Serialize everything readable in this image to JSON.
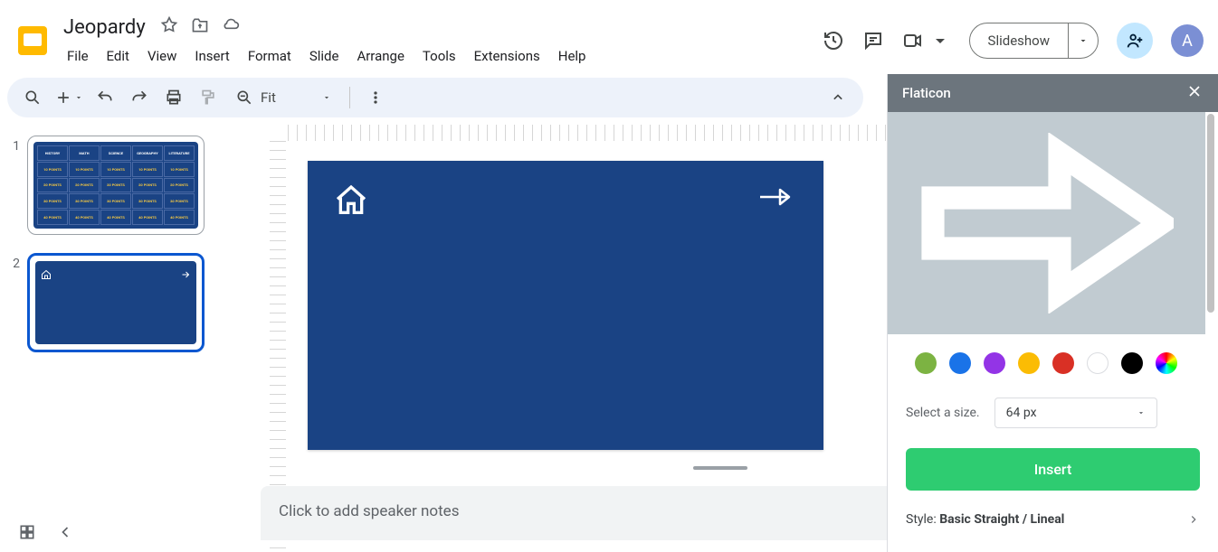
{
  "doc": {
    "title": "Jeopardy"
  },
  "menu": {
    "file": "File",
    "edit": "Edit",
    "view": "View",
    "insert": "Insert",
    "format": "Format",
    "slide": "Slide",
    "arrange": "Arrange",
    "tools": "Tools",
    "extensions": "Extensions",
    "help": "Help"
  },
  "header": {
    "slideshow": "Slideshow",
    "avatar": "A"
  },
  "toolbar": {
    "zoom_label": "Fit"
  },
  "slides": {
    "num1": "1",
    "num2": "2"
  },
  "jeopardy": {
    "headers": [
      "HISTORY",
      "MATH",
      "SCIENCE",
      "GEOGRAPHY",
      "LITERATURE"
    ],
    "rows": [
      "10 POINTS",
      "20 POINTS",
      "30 POINTS",
      "40 POINTS"
    ]
  },
  "notes": {
    "placeholder": "Click to add speaker notes"
  },
  "sidebar": {
    "title": "Flaticon",
    "size_label": "Select a size.",
    "size_value": "64 px",
    "insert_label": "Insert",
    "style_prefix": "Style: ",
    "style_name": "Basic Straight / Lineal",
    "colors": [
      "#7cb342",
      "#1a73e8",
      "#9334e6",
      "#fbbc04",
      "#d93025",
      "#ffffff",
      "#000000",
      "conic"
    ]
  }
}
